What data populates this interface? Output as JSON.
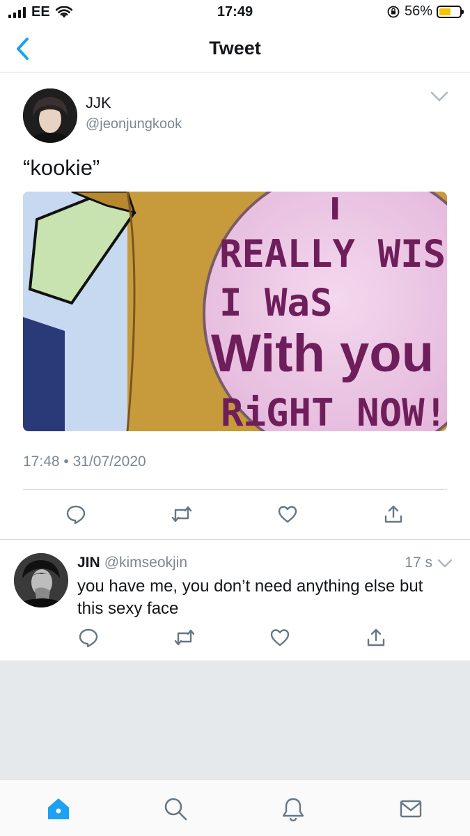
{
  "status_bar": {
    "carrier": "EE",
    "time": "17:49",
    "battery_percent": "56%",
    "battery_level": 0.56
  },
  "nav": {
    "title": "Tweet"
  },
  "tweet": {
    "name": "JJK",
    "handle": "@jeonjungkook",
    "text": "“kookie”",
    "timestamp": "17:48 • 31/07/2020",
    "media": {
      "caption_lines": [
        "I",
        "REALLY WISH",
        "I WaS",
        "With you",
        "RiGHT NOW!"
      ]
    }
  },
  "reply": {
    "name": "JIN",
    "handle": "@kimseokjin",
    "time": "17 s",
    "text": "you have me, you don’t need anything else but this sexy face"
  },
  "colors": {
    "accent": "#1da1f2",
    "icon_gray": "#657786",
    "divider": "#d5d9dc",
    "background_gray": "#e6e9ec"
  },
  "icons": [
    "back-chevron-icon",
    "wifi-icon",
    "signal-icon",
    "lock-rotation-icon",
    "battery-icon",
    "reply-icon",
    "retweet-icon",
    "like-icon",
    "share-icon",
    "home-icon",
    "search-icon",
    "notifications-icon",
    "messages-icon"
  ]
}
